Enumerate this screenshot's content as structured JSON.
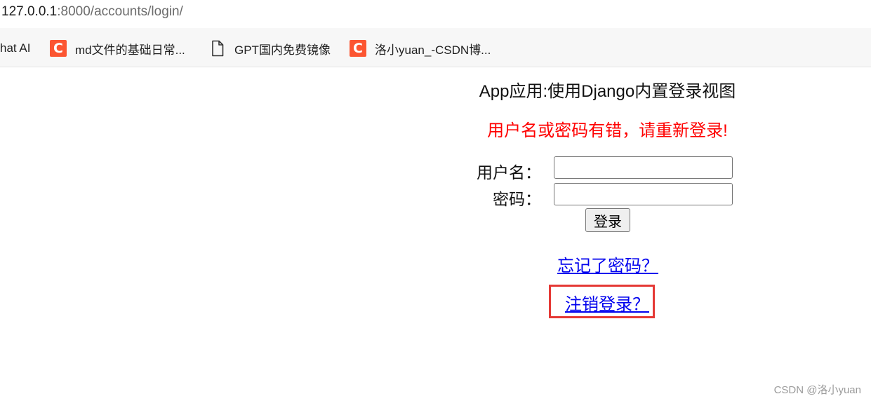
{
  "browser": {
    "address": {
      "host": "127.0.0.1",
      "rest": ":8000/accounts/login/"
    },
    "bookmarks": [
      {
        "label": "hat AI",
        "icon": "none"
      },
      {
        "label": "md文件的基础日常...",
        "icon": "csdn-icon"
      },
      {
        "label": "GPT国内免费镜像",
        "icon": "document-icon"
      },
      {
        "label": "洛小yuan_-CSDN博...",
        "icon": "csdn-icon"
      }
    ]
  },
  "page": {
    "title": "App应用:使用Django内置登录视图",
    "error": "用户名或密码有错，请重新登录!",
    "form": {
      "username_label": "用户名：",
      "password_label": "密码：",
      "username_value": "",
      "password_value": "",
      "submit_label": "登录"
    },
    "links": {
      "forgot_password": "忘记了密码？",
      "logout": "注销登录？"
    }
  },
  "watermark": "CSDN @洛小yuan",
  "colors": {
    "error": "#ff0000",
    "link": "#0000ee",
    "highlight": "#e53935",
    "csdn_brand": "#fc5531"
  }
}
